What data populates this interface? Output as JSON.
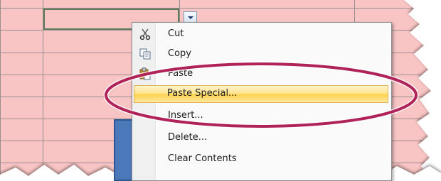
{
  "menu": {
    "items": [
      {
        "label": "Cut",
        "icon": "scissors-icon",
        "highlighted": false
      },
      {
        "label": "Copy",
        "icon": "copy-icon",
        "highlighted": false
      },
      {
        "label": "Paste",
        "icon": "paste-icon",
        "highlighted": false
      },
      {
        "label": "Paste Special...",
        "icon": "",
        "highlighted": true
      },
      {
        "label": "Insert...",
        "icon": "",
        "highlighted": false
      },
      {
        "label": "Delete...",
        "icon": "",
        "highlighted": false
      },
      {
        "label": "Clear Contents",
        "icon": "",
        "highlighted": false
      }
    ]
  },
  "colors": {
    "cell_fill": "#f9c4c4",
    "highlight": "#ffd24b",
    "callout_oval": "#b0235a",
    "shape_fill": "#4a78b8"
  }
}
